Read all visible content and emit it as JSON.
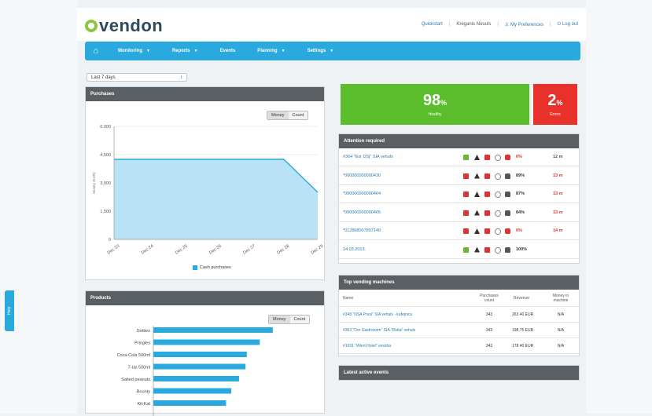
{
  "header": {
    "logo_text": "vendon",
    "quickstart": "Quickstart",
    "user_name": "Kreganis Nouuls",
    "preferences": "My Preferences",
    "logout": "Log out"
  },
  "nav": {
    "items": [
      "Monitoring",
      "Reports",
      "Events",
      "Planning",
      "Settings"
    ]
  },
  "period_select": "Last 7 days",
  "feedback_tab": "Help",
  "purchases": {
    "title": "Purchases",
    "toggle": [
      "Money",
      "Count"
    ],
    "legend": "Cash purchases",
    "ylabel": "Money (EUR)"
  },
  "products": {
    "title": "Products",
    "toggle": [
      "Money",
      "Count"
    ]
  },
  "tiles": {
    "healthy_value": "98",
    "healthy_unit": "%",
    "healthy_label": "Healthy",
    "errors_value": "2",
    "errors_unit": "%",
    "errors_label": "Errors",
    "healthy_color": "#5bbd2b",
    "errors_color": "#e8312b"
  },
  "attention": {
    "title": "Attention required",
    "rows": [
      {
        "label": "#364 \"Esr DSj\" SIA vehuls",
        "pct": "0%",
        "time": "12 m",
        "pct_color": "#d33"
      },
      {
        "label": "*000000000000430",
        "pct": "89%",
        "time": "13 m",
        "pct_color": "#333"
      },
      {
        "label": "*000000000000404",
        "pct": "87%",
        "time": "13 m",
        "pct_color": "#333"
      },
      {
        "label": "*000000000000405",
        "pct": "84%",
        "time": "13 m",
        "pct_color": "#333"
      },
      {
        "label": "*012868007897140",
        "pct": "0%",
        "time": "14 m",
        "pct_color": "#d33"
      },
      {
        "label": "14.03.2013.",
        "pct": "100%",
        "time": "",
        "pct_color": "#333"
      }
    ]
  },
  "top_machines": {
    "title": "Top vending machines",
    "columns": [
      "Name",
      "Purchases count",
      "Revenue",
      "Money in machine"
    ],
    "rows": [
      {
        "name": "#348 \"NSA Prusi\" SIA vehuls - kafejnica",
        "count": "343",
        "revenue": "263.40 EUR",
        "money": "N/A"
      },
      {
        "name": "#363 \"Dor Gastronom\" SIA \"Rutta\" vehuls",
        "count": "343",
        "revenue": "198.75 EUR",
        "money": "N/A"
      },
      {
        "name": "#1001 \"Wiert Hotel\" vesirba",
        "count": "343",
        "revenue": "178.40 EUR",
        "money": "N/A"
      }
    ]
  },
  "latest_events": {
    "title": "Latest active events"
  },
  "chart_data": [
    {
      "type": "area",
      "x": [
        "Dec 23",
        "Dec 24",
        "Dec 25",
        "Dec 26",
        "Dec 27",
        "Dec 28",
        "Dec 29"
      ],
      "values": [
        4250,
        4250,
        4250,
        4250,
        4250,
        4250,
        2500
      ],
      "yticks": [
        0,
        1500,
        3000,
        4500,
        6000
      ],
      "ytick_labels": [
        "0",
        "1,500",
        "3,000",
        "4,500",
        "6,000"
      ],
      "ylim": [
        0,
        6000
      ],
      "series": [
        {
          "name": "Cash purchases",
          "color": "#29a9de"
        }
      ],
      "legend": "bottom"
    },
    {
      "type": "bar",
      "orientation": "horizontal",
      "categories": [
        "Gottiex",
        "Pringles",
        "Coca-Cola 500ml",
        "7-Up 500ml",
        "Salted peanuts",
        "Bounty",
        "Kit-Kat"
      ],
      "values": [
        92,
        82,
        72,
        71,
        66,
        60,
        56
      ],
      "color": "#29a9de"
    }
  ]
}
